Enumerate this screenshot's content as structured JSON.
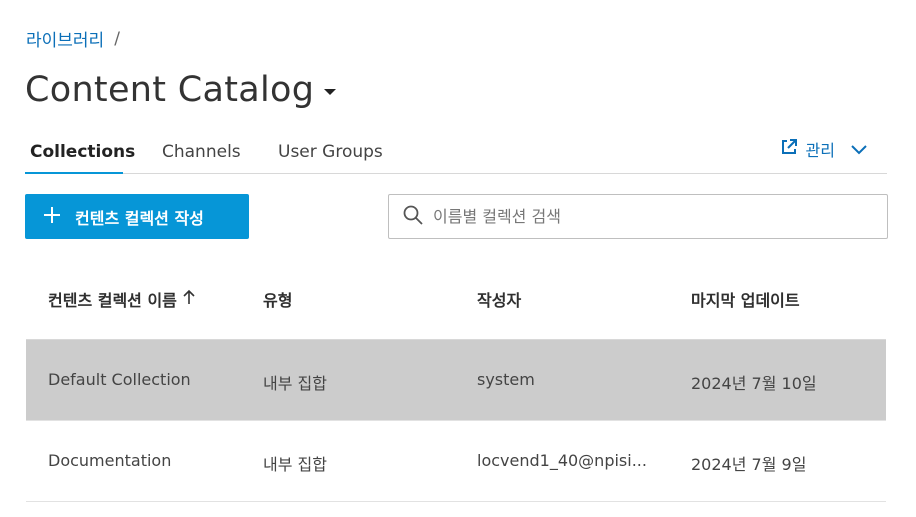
{
  "breadcrumb": {
    "library": "라이브러리",
    "separator": "/"
  },
  "page_title": "Content Catalog",
  "tabs": [
    {
      "label": "Collections",
      "active": true
    },
    {
      "label": "Channels",
      "active": false
    },
    {
      "label": "User Groups",
      "active": false
    }
  ],
  "manage": {
    "label": "관리",
    "icon": "external-link-icon"
  },
  "create_button": {
    "label": "컨텐츠 컬렉션 작성",
    "icon": "plus-icon"
  },
  "search": {
    "placeholder": "이름별 컬렉션 검색",
    "value": ""
  },
  "table": {
    "columns": [
      "컨텐츠 컬렉션 이름",
      "유형",
      "작성자",
      "마지막 업데이트"
    ],
    "sort_icon": "arrow-up-icon",
    "rows": [
      {
        "name": "Default Collection",
        "type": "내부 집합",
        "author": "system",
        "updated": "2024년 7월 10일",
        "selected": true
      },
      {
        "name": "Documentation",
        "type": "내부 집합",
        "author": "locvend1_40@npisi...",
        "updated": "2024년 7월 9일",
        "selected": false
      }
    ]
  },
  "colors": {
    "accent": "#0696d7",
    "link": "#0b6fb8",
    "selected_row": "#cccccc"
  }
}
